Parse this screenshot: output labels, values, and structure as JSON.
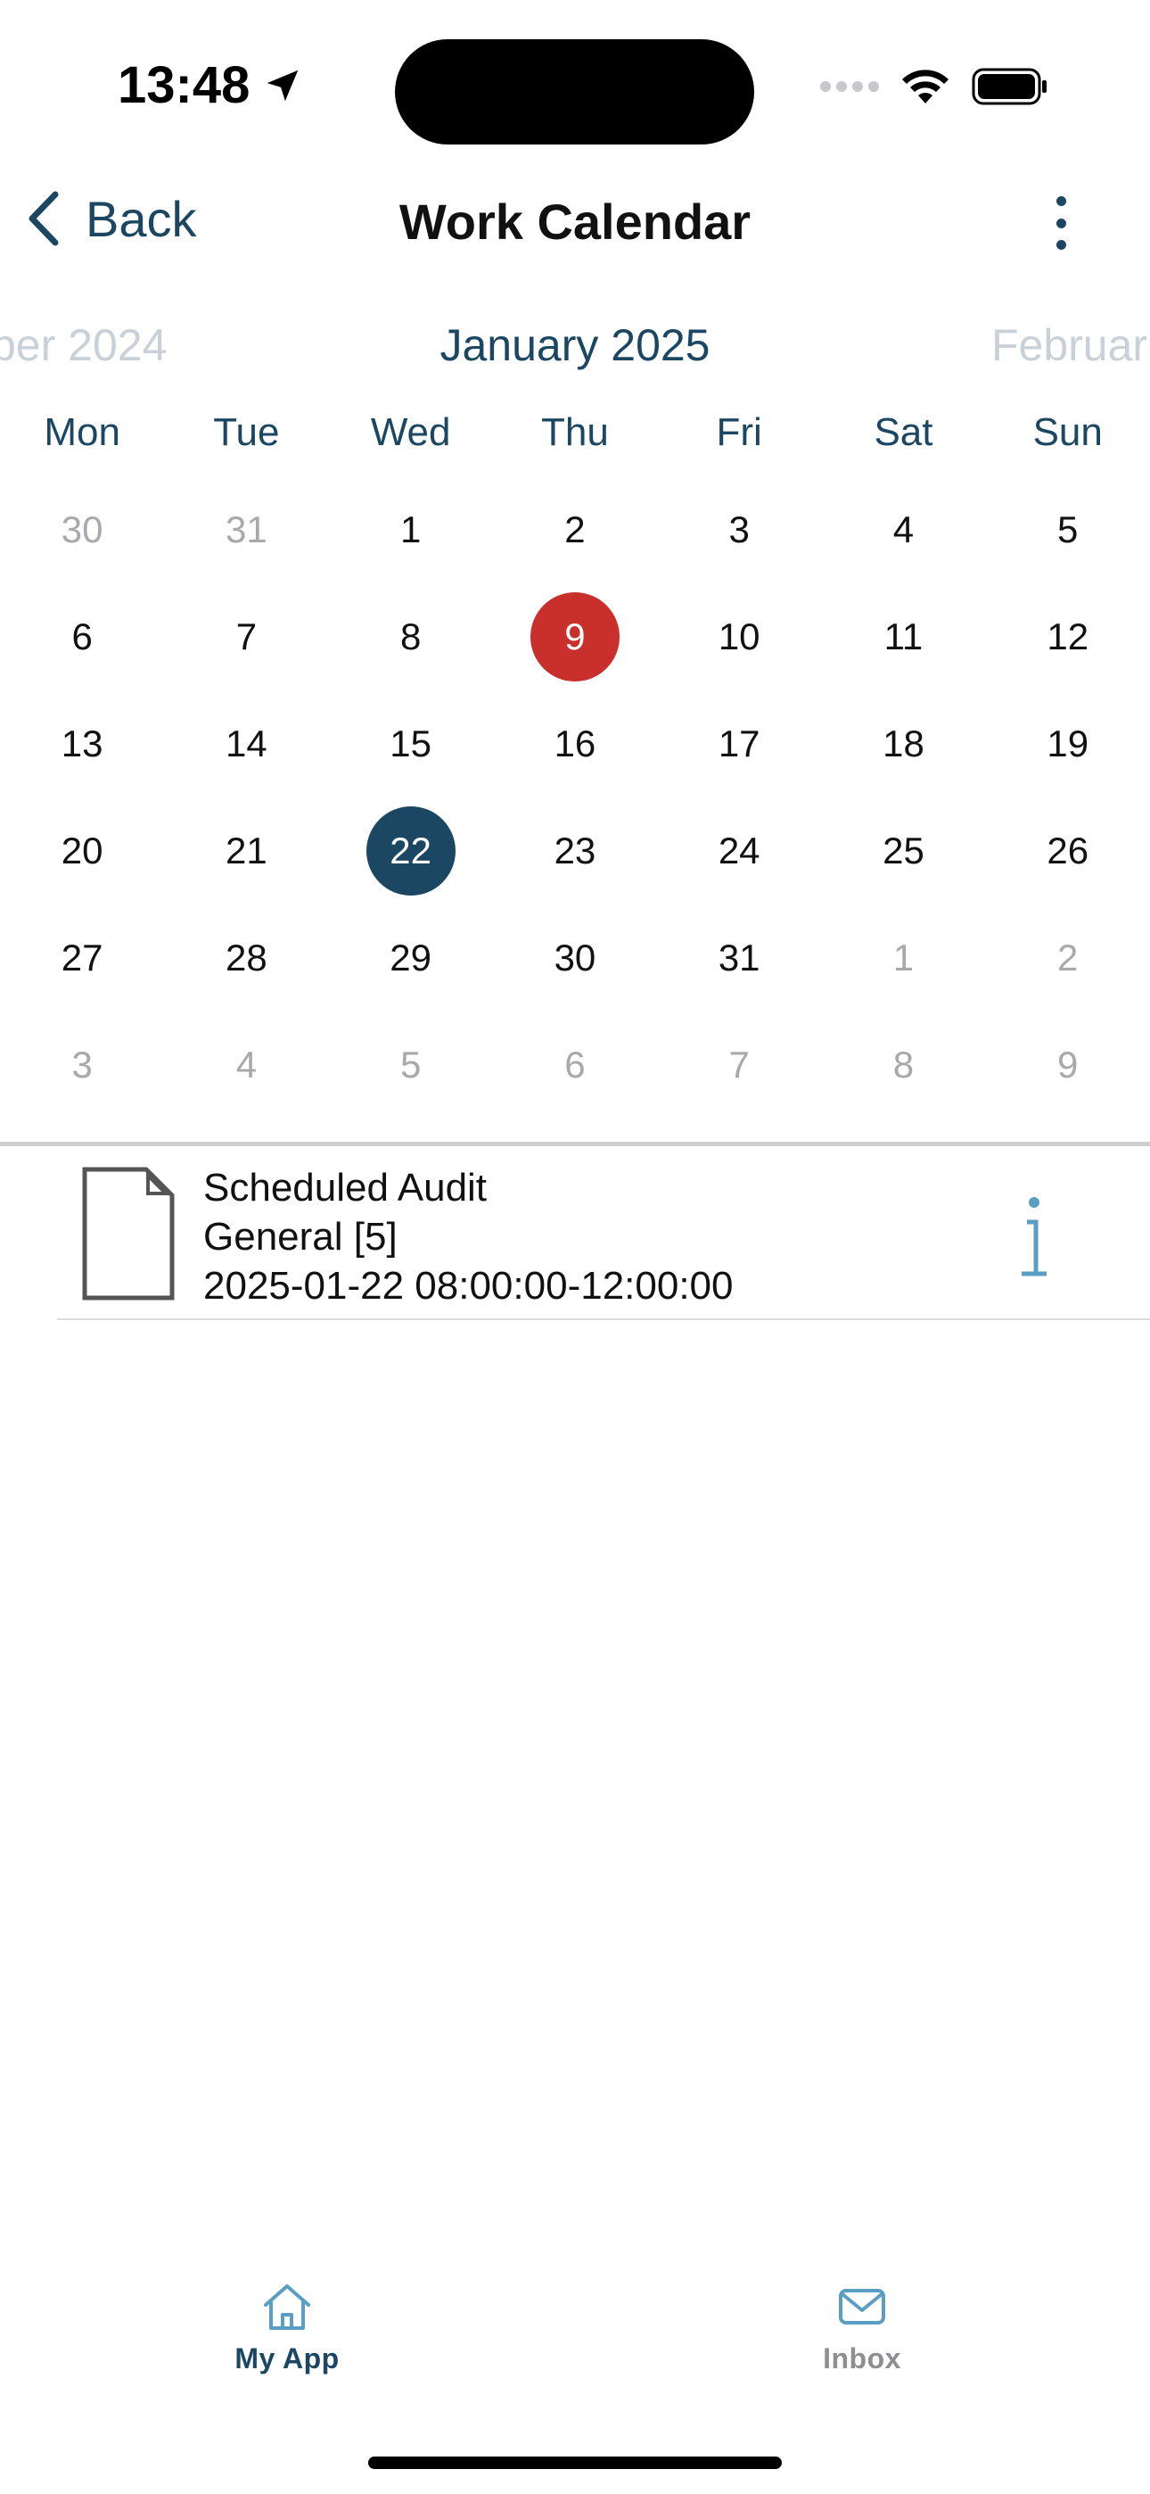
{
  "status_bar": {
    "time": "13:48"
  },
  "nav": {
    "back_label": "Back",
    "title": "Work Calendar"
  },
  "month_header": {
    "previous": "ber 2024",
    "current": "January 2025",
    "next": "Februar"
  },
  "calendar": {
    "weekdays": [
      "Mon",
      "Tue",
      "Wed",
      "Thu",
      "Fri",
      "Sat",
      "Sun"
    ],
    "today": "9",
    "selected": "22",
    "weeks": [
      [
        {
          "d": "30",
          "other": true
        },
        {
          "d": "31",
          "other": true
        },
        {
          "d": "1"
        },
        {
          "d": "2"
        },
        {
          "d": "3"
        },
        {
          "d": "4"
        },
        {
          "d": "5"
        }
      ],
      [
        {
          "d": "6"
        },
        {
          "d": "7"
        },
        {
          "d": "8"
        },
        {
          "d": "9",
          "today": true
        },
        {
          "d": "10"
        },
        {
          "d": "11"
        },
        {
          "d": "12"
        }
      ],
      [
        {
          "d": "13"
        },
        {
          "d": "14"
        },
        {
          "d": "15"
        },
        {
          "d": "16"
        },
        {
          "d": "17"
        },
        {
          "d": "18"
        },
        {
          "d": "19"
        }
      ],
      [
        {
          "d": "20"
        },
        {
          "d": "21"
        },
        {
          "d": "22",
          "selected": true
        },
        {
          "d": "23"
        },
        {
          "d": "24"
        },
        {
          "d": "25"
        },
        {
          "d": "26"
        }
      ],
      [
        {
          "d": "27"
        },
        {
          "d": "28"
        },
        {
          "d": "29"
        },
        {
          "d": "30"
        },
        {
          "d": "31"
        },
        {
          "d": "1",
          "other": true
        },
        {
          "d": "2",
          "other": true
        }
      ],
      [
        {
          "d": "3",
          "other": true
        },
        {
          "d": "4",
          "other": true
        },
        {
          "d": "5",
          "other": true
        },
        {
          "d": "6",
          "other": true
        },
        {
          "d": "7",
          "other": true
        },
        {
          "d": "8",
          "other": true
        },
        {
          "d": "9",
          "other": true
        }
      ]
    ]
  },
  "events": [
    {
      "title": "Scheduled Audit",
      "category": "General [5]",
      "time_range": "2025-01-22 08:00:00-12:00:00",
      "icon": "document-icon",
      "action_icon": "info-icon"
    }
  ],
  "tab_bar": {
    "tabs": [
      {
        "label": "My App",
        "icon": "home-icon",
        "active": true
      },
      {
        "label": "Inbox",
        "icon": "mail-icon",
        "active": false
      }
    ]
  },
  "colors": {
    "accent": "#1b4763",
    "today": "#c9302c",
    "muted": "#a9a9ad",
    "info": "#5b9ec4"
  }
}
